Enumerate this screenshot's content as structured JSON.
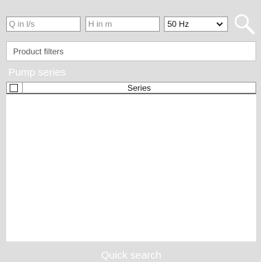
{
  "inputs": {
    "flow_placeholder": "Q in l/s",
    "head_placeholder": "H in m"
  },
  "frequency": {
    "selected": "50 Hz"
  },
  "icons": {
    "search": "search-icon",
    "dropdown": "chevron-down-icon"
  },
  "filters": {
    "label": "Product filters"
  },
  "pump_series": {
    "title": "Pump series",
    "columns": [
      "Series"
    ],
    "rows": []
  },
  "footer": {
    "quick_search_label": "Quick search"
  },
  "colors": {
    "panel_background": "#dedede",
    "field_border": "#9a9a9a",
    "section_title_text": "#ffffff"
  }
}
